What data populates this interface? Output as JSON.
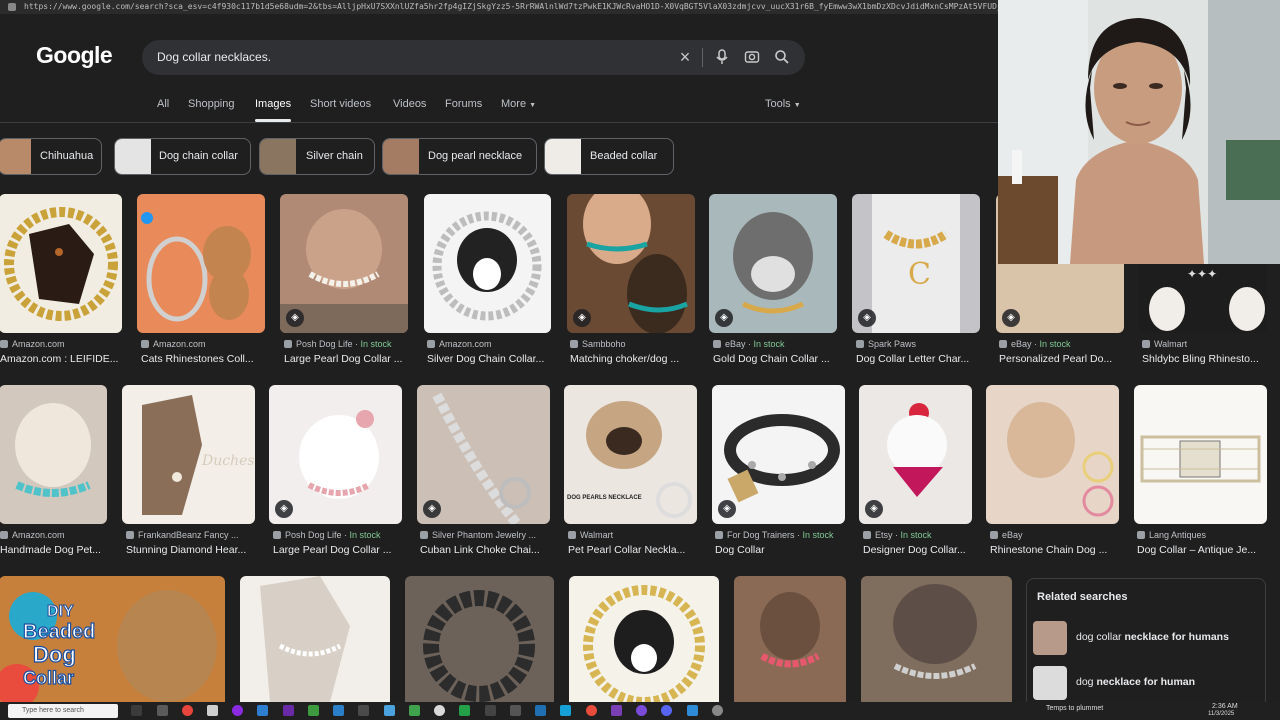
{
  "browser": {
    "url": "https://www.google.com/search?sca_esv=c4f930c117b1d5e68udm=2&tbs=AlljpHxU7SXXnlUZfa5hr2fp4gIZjSkgYzz5-5RrRWAlnlWd7tzPwkE1KJWcRvaHO1D-X0VqBGT5VlaX03zdmjcvv_uucX31r6B_fyEmww3wX1bmDzXDcvJdidMxnCsMPzAt5VFUD_28GE12EZHgnA6G-WX_f4K4jhjOEqz7aC_wZTih-NvwaldKSRg"
  },
  "logo": "Google",
  "search": {
    "query": "Dog collar necklaces."
  },
  "tabs": [
    {
      "label": "All",
      "active": false
    },
    {
      "label": "Shopping",
      "active": false
    },
    {
      "label": "Images",
      "active": true
    },
    {
      "label": "Short videos",
      "active": false
    },
    {
      "label": "Videos",
      "active": false
    },
    {
      "label": "Forums",
      "active": false
    },
    {
      "label": "More",
      "active": false
    }
  ],
  "tools_label": "Tools",
  "chips": [
    "Chihuahua",
    "Dog chain collar",
    "Silver chain",
    "Dog pearl necklace",
    "Beaded collar"
  ],
  "row1": [
    {
      "source": "Amazon.com",
      "stock": "",
      "title": "Amazon.com : LEIFIDE...",
      "color": "#c9a23a"
    },
    {
      "source": "Amazon.com",
      "stock": "",
      "title": "Cats Rhinestones Coll...",
      "color": "#e98a5a"
    },
    {
      "source": "Posh Dog Life",
      "stock": "In stock",
      "title": "Large Pearl Dog Collar ...",
      "color": "#b08a74"
    },
    {
      "source": "Amazon.com",
      "stock": "",
      "title": "Silver Dog Chain Collar...",
      "color": "#e9e9ea"
    },
    {
      "source": "Sambboho",
      "stock": "",
      "title": "Matching choker/dog ...",
      "color": "#6b4a34"
    },
    {
      "source": "eBay",
      "stock": "In stock",
      "title": "Gold Dog Chain Collar ...",
      "color": "#a9b8bb"
    },
    {
      "source": "Spark Paws",
      "stock": "",
      "title": "Dog Collar Letter Char...",
      "color": "#c4c4c8"
    },
    {
      "source": "eBay",
      "stock": "In stock",
      "title": "Personalized Pearl Do...",
      "color": "#d9c3a9"
    },
    {
      "source": "Walmart",
      "stock": "",
      "title": "Shldybc Bling Rhinesto...",
      "color": "#1d1d1d"
    }
  ],
  "row2": [
    {
      "source": "Amazon.com",
      "stock": "",
      "title": "Handmade Dog Pet...",
      "color": "#d2c8bd"
    },
    {
      "source": "FrankandBeanz Fancy ...",
      "stock": "",
      "title": "Stunning Diamond Hear...",
      "color": "#8a6e58"
    },
    {
      "source": "Posh Dog Life",
      "stock": "In stock",
      "title": "Large Pearl Dog Collar ...",
      "color": "#f2eeee"
    },
    {
      "source": "Silver Phantom Jewelry ...",
      "stock": "",
      "title": "Cuban Link Choke Chai...",
      "color": "#cbbfb6"
    },
    {
      "source": "Walmart",
      "stock": "",
      "title": "Pet Pearl Collar Neckla...",
      "color": "#ece6e1"
    },
    {
      "source": "For Dog Trainers",
      "stock": "In stock",
      "title": "Dog Collar",
      "color": "#f4f4f4"
    },
    {
      "source": "Etsy",
      "stock": "In stock",
      "title": "Designer Dog Collar...",
      "color": "#ebe8e6"
    },
    {
      "source": "eBay",
      "stock": "",
      "title": "Rhinestone Chain Dog ...",
      "color": "#e7d6c8"
    },
    {
      "source": "Lang Antiques",
      "stock": "",
      "title": "Dog Collar – Antique Je...",
      "color": "#f1eee8"
    }
  ],
  "row3": [
    {
      "color": "#c77f3c",
      "text": "DIY Beaded Dog Collar"
    },
    {
      "color": "#d8cfc6"
    },
    {
      "color": "#6d625a"
    },
    {
      "color": "#d6b552"
    },
    {
      "color": "#8a6a54"
    },
    {
      "color": "#7f6e5d"
    }
  ],
  "related": {
    "heading": "Related searches",
    "items": [
      {
        "plain": "dog collar ",
        "bold": "necklace for humans",
        "color": "#b89a8a"
      },
      {
        "plain": "dog ",
        "bold": "necklace for human",
        "color": "#dcdcdc"
      }
    ]
  },
  "taskbar": {
    "search": "Type here to search",
    "weather": "Temps to plummet",
    "time": "2:36 AM",
    "date": "11/3/2025"
  }
}
